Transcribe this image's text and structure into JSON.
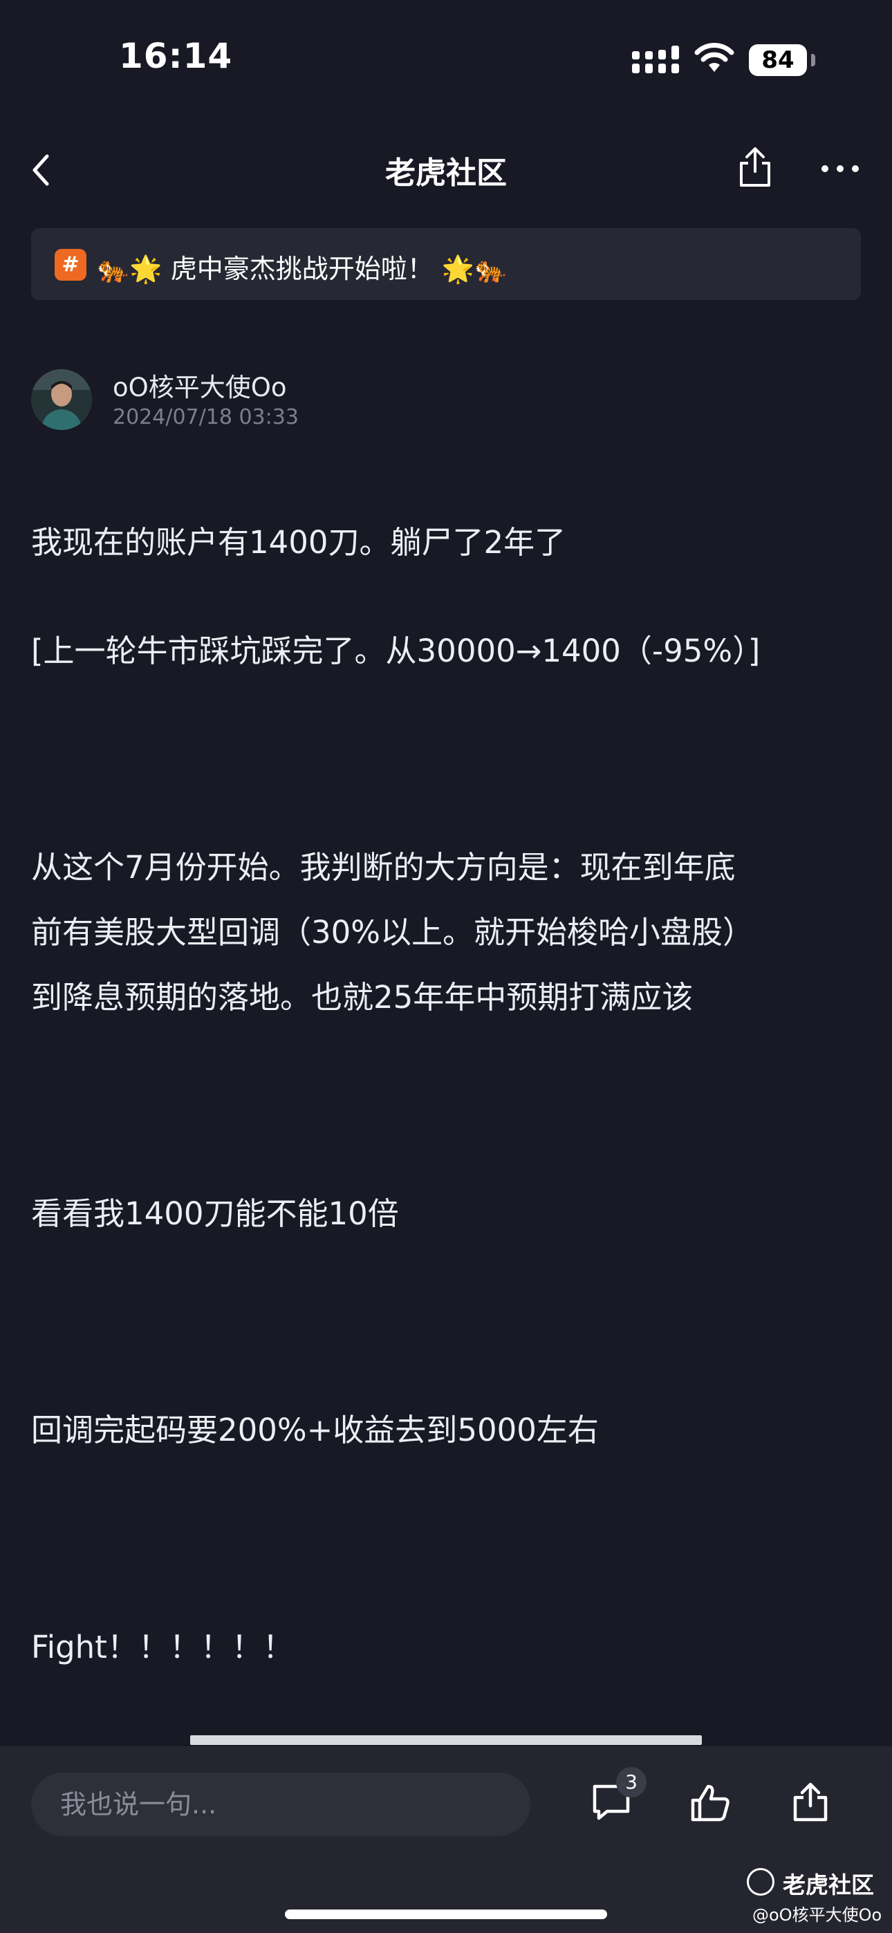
{
  "status_bar": {
    "time": "16:14",
    "battery": "84"
  },
  "nav": {
    "title": "老虎社区",
    "back_icon": "chevron-left-icon",
    "share_icon": "share-icon",
    "more_icon": "more-horizontal-icon"
  },
  "banner": {
    "tag": "#",
    "text": "🐅🌟 虎中豪杰挑战开始啦！ 🌟🐅"
  },
  "author": {
    "name": "oO核平大使Oo",
    "time": "2024/07/18 03:33"
  },
  "post": {
    "lines": [
      "我现在的账户有1400刀。躺尸了2年了",
      "[上一轮牛市踩坑踩完了。从30000→1400（-95%）]",
      "从这个7月份开始。我判断的大方向是：现在到年底",
      "前有美股大型回调（30%以上。就开始梭哈小盘股）",
      "到降息预期的落地。也就25年年中预期打满应该",
      "看看我1400刀能不能10倍",
      "回调完起码要200%+收益去到5000左右",
      "Fight！！！！！！"
    ]
  },
  "bottom_bar": {
    "comment_placeholder": "我也说一句...",
    "comment_count": "3",
    "icons": [
      "comment-icon",
      "like-icon",
      "forward-icon"
    ]
  },
  "watermark": {
    "brand": "老虎社区",
    "user": "@oO核平大使Oo"
  },
  "colors": {
    "background": "#181924",
    "banner_bg": "#262833",
    "tag_orange": "#ee6a22",
    "bottom_bar": "#24252f"
  }
}
